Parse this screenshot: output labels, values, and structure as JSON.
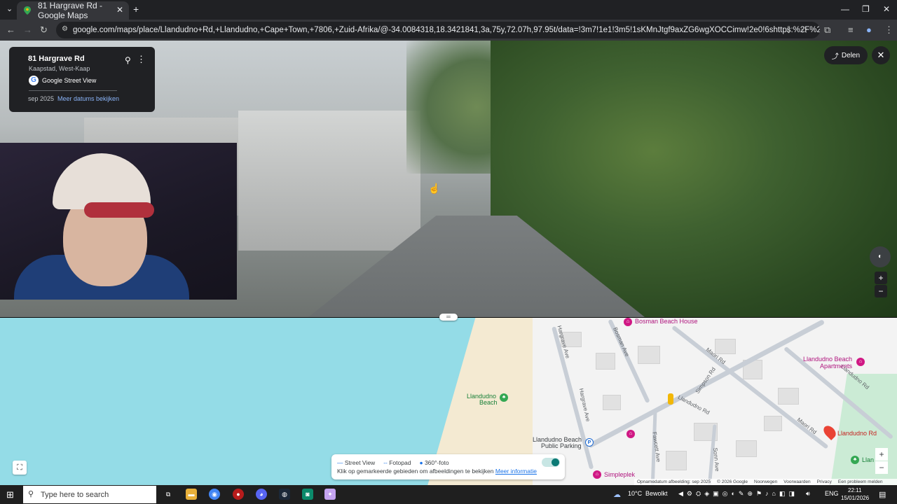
{
  "browser": {
    "tab_title": "81 Hargrave Rd - Google Maps",
    "url": "google.com/maps/place/Llandudno+Rd,+Llandudno,+Cape+Town,+7806,+Zuid-Afrika/@-34.0084318,18.3421841,3a,75y,72.07h,97.95t/data=!3m7!1e1!3m5!1sKMnJtgf9axZG6wgXOCCimw!2e0!6shttps:%2F%2Fstreetviewpixels-pa.googleapis.co..."
  },
  "streetview": {
    "address": "81 Hargrave Rd",
    "city": "Kaapstad, West-Kaap",
    "source": "Google Street View",
    "date": "sep 2025",
    "more_dates": "Meer datums bekijken",
    "share_label": "Delen"
  },
  "map": {
    "poi": {
      "bosman": "Bosman Beach House",
      "apartments_1": "Llandudno Beach",
      "apartments_2": "Apartments",
      "beach_1": "Llandudno",
      "beach_2": "Beach",
      "parking_1": "Llandudno Beach",
      "parking_2": "Public Parking",
      "simpleplek": "Simpleplek",
      "llandudno_rd": "Llandudno Rd",
      "cut_off": "Llan"
    },
    "roads": {
      "hargrave_1": "Hargrave Ave",
      "hargrave_2": "Hargrave Ave",
      "bosman": "Bosman Ave",
      "maori_1": "Maori Rd",
      "maori_2": "Maori Rd",
      "simpson": "Simpson Rd",
      "llandudno_1": "Llandudno Rd",
      "llandudno_2": "Llandudno Rd",
      "fawcett": "Fawcett Ave",
      "sonn": "Sonn Ave"
    },
    "legend": {
      "street_view": "Street View",
      "photo_path": "Fotopad",
      "photo_360": "360°-foto",
      "hint": "Klik op gemarkeerde gebieden om afbeeldingen te bekijken",
      "more_info": "Meer informatie"
    },
    "attribution": [
      "Opnamedatum afbeelding: sep 2025",
      "© 2026 Google",
      "Noorwegen",
      "Voorwaarden",
      "Privacy",
      "Een probleem melden"
    ]
  },
  "taskbar": {
    "search_placeholder": "Type here to search",
    "weather": "10°C",
    "weather_desc": "Bewolkt",
    "lang": "ENG",
    "time": "22:11",
    "date": "15/01/2026"
  },
  "colors": {
    "accent": "#1a73e8",
    "pin": "#ea4335",
    "ocean": "#94dce7"
  }
}
